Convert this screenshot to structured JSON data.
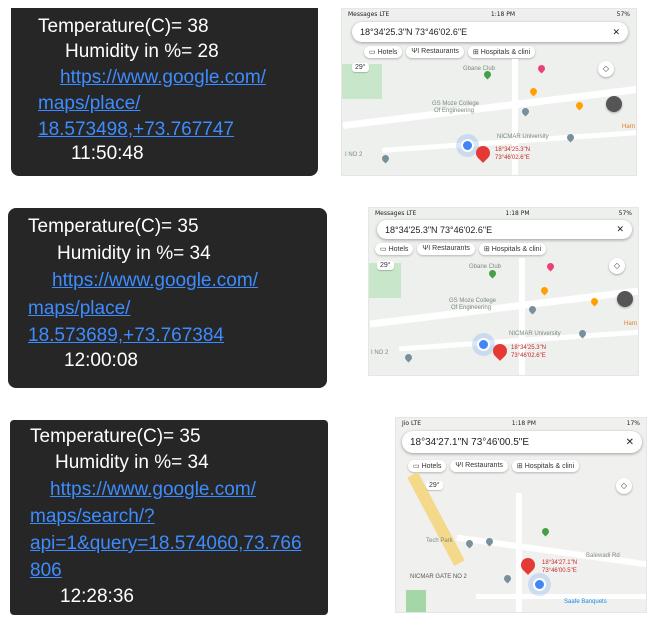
{
  "messages": [
    {
      "temperature": "Temperature(C)= 38",
      "humidity": "Humidity in %= 28",
      "link_lines": [
        "https://www.google.com/",
        "maps/place/",
        "18.573498,+73.767747"
      ],
      "time": "11:50:48"
    },
    {
      "temperature": "Temperature(C)= 35",
      "humidity": "Humidity in %= 34",
      "link_lines": [
        "https://www.google.com/",
        "maps/place/",
        "18.573689,+73.767384"
      ],
      "time": "12:00:08"
    },
    {
      "temperature": "Temperature(C)= 35",
      "humidity": "Humidity in %= 34",
      "link_lines": [
        "https://www.google.com/",
        "maps/search/?",
        "api=1&query=18.574060,73.766",
        "806"
      ],
      "time": "12:28:36"
    }
  ],
  "maps": [
    {
      "status_carrier": "Messages LTE",
      "status_time": "1:18 PM",
      "status_battery": "57%",
      "search_text": "18°34'25.3\"N 73°46'02.6\"E",
      "close_glyph": "✕",
      "chips": [
        "Hotels",
        "Restaurants",
        "Hospitals & clini"
      ],
      "temp_badge": "29°",
      "places": [
        "Gbane Club",
        "GS Moze College",
        "Of Engineering",
        "NICMAR University",
        "I NO 2",
        "Harn"
      ],
      "pin_label": [
        "18°34'25.3\"N",
        "73°46'02.6\"E"
      ]
    },
    {
      "status_carrier": "Messages LTE",
      "status_time": "1:18 PM",
      "status_battery": "57%",
      "search_text": "18°34'25.3\"N 73°46'02.6\"E",
      "close_glyph": "✕",
      "chips": [
        "Hotels",
        "Restaurants",
        "Hospitals & clini"
      ],
      "temp_badge": "29°",
      "places": [
        "Gbane Club",
        "GS Moze College",
        "Of Engineering",
        "NICMAR University",
        "I NO 2",
        "Harn"
      ],
      "pin_label": [
        "18°34'25.3\"N",
        "73°46'02.6\"E"
      ]
    },
    {
      "status_carrier": "Jio LTE",
      "status_time": "1:18 PM",
      "status_battery": "17%",
      "search_text": "18°34'27.1\"N 73°46'00.5\"E",
      "close_glyph": "✕",
      "chips": [
        "Hotels",
        "Restaurants",
        "Hospitals & clini"
      ],
      "temp_badge": "29°",
      "places": [
        "Tech Park",
        "NICMAR GATE NO 2",
        "Balewadi Rd",
        "Saafe Banquets"
      ],
      "pin_label": [
        "18°34'27.1\"N",
        "73°46'00.5\"E"
      ]
    }
  ]
}
